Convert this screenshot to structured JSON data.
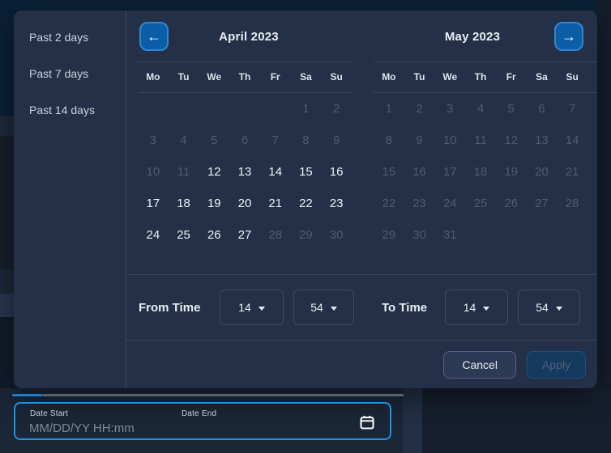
{
  "colors": {
    "accent_blue": "#1f93e0",
    "nav_button_bg": "#0b5da6",
    "nav_button_border": "#2f87cf",
    "panel_bg": "#243047",
    "backdrop_bg": "#0a2036",
    "apply_disabled_bg": "#16395e",
    "progress_blue": "#1d7ccc",
    "enabled_day": "#edf1f7",
    "disabled_day": "#4f5b70"
  },
  "icons": {
    "prev_arrow": "←",
    "next_arrow": "→"
  },
  "presets": [
    {
      "label": "Past 2 days",
      "name": "preset-past-2-days"
    },
    {
      "label": "Past 7 days",
      "name": "preset-past-7-days"
    },
    {
      "label": "Past 14 days",
      "name": "preset-past-14-days"
    }
  ],
  "calendars": [
    {
      "title": "April 2023",
      "slug": "april",
      "weekdays": [
        "Mo",
        "Tu",
        "We",
        "Th",
        "Fr",
        "Sa",
        "Su"
      ],
      "weeks": [
        [
          {
            "d": "",
            "s": "empty"
          },
          {
            "d": "",
            "s": "empty"
          },
          {
            "d": "",
            "s": "empty"
          },
          {
            "d": "",
            "s": "empty"
          },
          {
            "d": "",
            "s": "empty"
          },
          {
            "d": "1",
            "s": "disabled"
          },
          {
            "d": "2",
            "s": "disabled"
          }
        ],
        [
          {
            "d": "3",
            "s": "disabled"
          },
          {
            "d": "4",
            "s": "disabled"
          },
          {
            "d": "5",
            "s": "disabled"
          },
          {
            "d": "6",
            "s": "disabled"
          },
          {
            "d": "7",
            "s": "disabled"
          },
          {
            "d": "8",
            "s": "disabled"
          },
          {
            "d": "9",
            "s": "disabled"
          }
        ],
        [
          {
            "d": "10",
            "s": "disabled"
          },
          {
            "d": "11",
            "s": "disabled"
          },
          {
            "d": "12",
            "s": "enabled"
          },
          {
            "d": "13",
            "s": "enabled"
          },
          {
            "d": "14",
            "s": "enabled"
          },
          {
            "d": "15",
            "s": "enabled"
          },
          {
            "d": "16",
            "s": "enabled"
          }
        ],
        [
          {
            "d": "17",
            "s": "enabled"
          },
          {
            "d": "18",
            "s": "enabled"
          },
          {
            "d": "19",
            "s": "enabled"
          },
          {
            "d": "20",
            "s": "enabled"
          },
          {
            "d": "21",
            "s": "enabled"
          },
          {
            "d": "22",
            "s": "enabled"
          },
          {
            "d": "23",
            "s": "enabled"
          }
        ],
        [
          {
            "d": "24",
            "s": "enabled"
          },
          {
            "d": "25",
            "s": "enabled"
          },
          {
            "d": "26",
            "s": "enabled"
          },
          {
            "d": "27",
            "s": "enabled"
          },
          {
            "d": "28",
            "s": "disabled"
          },
          {
            "d": "29",
            "s": "disabled"
          },
          {
            "d": "30",
            "s": "disabled"
          }
        ]
      ]
    },
    {
      "title": "May 2023",
      "slug": "may",
      "weekdays": [
        "Mo",
        "Tu",
        "We",
        "Th",
        "Fr",
        "Sa",
        "Su"
      ],
      "weeks": [
        [
          {
            "d": "1",
            "s": "disabled"
          },
          {
            "d": "2",
            "s": "disabled"
          },
          {
            "d": "3",
            "s": "disabled"
          },
          {
            "d": "4",
            "s": "disabled"
          },
          {
            "d": "5",
            "s": "disabled"
          },
          {
            "d": "6",
            "s": "disabled"
          },
          {
            "d": "7",
            "s": "disabled"
          }
        ],
        [
          {
            "d": "8",
            "s": "disabled"
          },
          {
            "d": "9",
            "s": "disabled"
          },
          {
            "d": "10",
            "s": "disabled"
          },
          {
            "d": "11",
            "s": "disabled"
          },
          {
            "d": "12",
            "s": "disabled"
          },
          {
            "d": "13",
            "s": "disabled"
          },
          {
            "d": "14",
            "s": "disabled"
          }
        ],
        [
          {
            "d": "15",
            "s": "disabled"
          },
          {
            "d": "16",
            "s": "disabled"
          },
          {
            "d": "17",
            "s": "disabled"
          },
          {
            "d": "18",
            "s": "disabled"
          },
          {
            "d": "19",
            "s": "disabled"
          },
          {
            "d": "20",
            "s": "disabled"
          },
          {
            "d": "21",
            "s": "disabled"
          }
        ],
        [
          {
            "d": "22",
            "s": "disabled"
          },
          {
            "d": "23",
            "s": "disabled"
          },
          {
            "d": "24",
            "s": "disabled"
          },
          {
            "d": "25",
            "s": "disabled"
          },
          {
            "d": "26",
            "s": "disabled"
          },
          {
            "d": "27",
            "s": "disabled"
          },
          {
            "d": "28",
            "s": "disabled"
          }
        ],
        [
          {
            "d": "29",
            "s": "disabled"
          },
          {
            "d": "30",
            "s": "disabled"
          },
          {
            "d": "31",
            "s": "disabled"
          },
          {
            "d": "",
            "s": "empty"
          },
          {
            "d": "",
            "s": "empty"
          },
          {
            "d": "",
            "s": "empty"
          },
          {
            "d": "",
            "s": "empty"
          }
        ]
      ]
    }
  ],
  "time": {
    "from_label": "From Time",
    "to_label": "To Time",
    "from_hour": "14",
    "from_minute": "54",
    "to_hour": "14",
    "to_minute": "54"
  },
  "footer": {
    "cancel_label": "Cancel",
    "apply_label": "Apply"
  },
  "bottom": {
    "start_label": "Date Start",
    "start_placeholder": "MM/DD/YY HH:mm",
    "end_label": "Date End"
  }
}
